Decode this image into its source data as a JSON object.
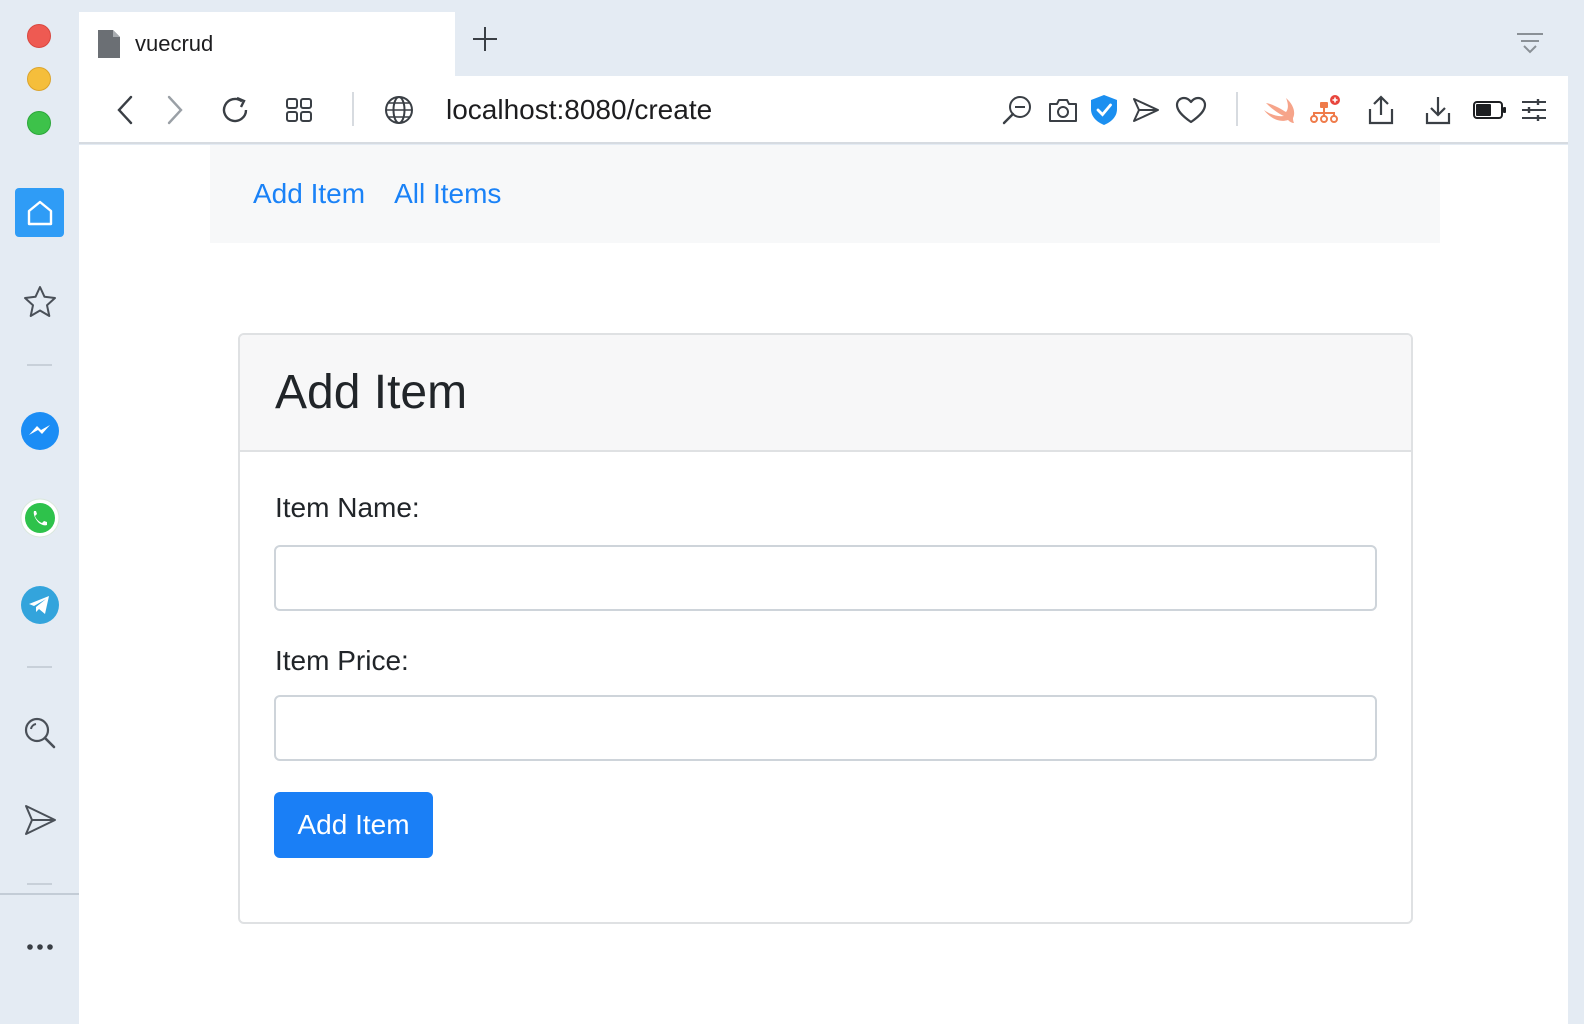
{
  "browser": {
    "tab_title": "vuecrud",
    "url": "localhost:8080/create"
  },
  "nav": {
    "links": [
      {
        "label": "Add Item"
      },
      {
        "label": "All Items"
      }
    ]
  },
  "form": {
    "title": "Add Item",
    "item_name_label": "Item Name:",
    "item_name_value": "",
    "item_price_label": "Item Price:",
    "item_price_value": "",
    "submit_label": "Add Item"
  },
  "colors": {
    "link": "#1a82f7",
    "primary_button": "#1a7ff6",
    "sidebar_active": "#2f9cf6"
  },
  "icons": {
    "sidebar": [
      "home-icon",
      "star-icon",
      "messenger-icon",
      "whatsapp-icon",
      "telegram-icon",
      "search-icon",
      "send-icon",
      "more-icon"
    ],
    "toolbar": [
      "back-icon",
      "forward-icon",
      "reload-icon",
      "tabs-grid-icon",
      "globe-icon",
      "zoom-out-icon",
      "camera-icon",
      "shield-check-icon",
      "send-icon",
      "heart-icon",
      "swift-icon",
      "sitemap-icon",
      "share-icon",
      "download-icon",
      "battery-icon",
      "settings-sliders-icon"
    ]
  }
}
